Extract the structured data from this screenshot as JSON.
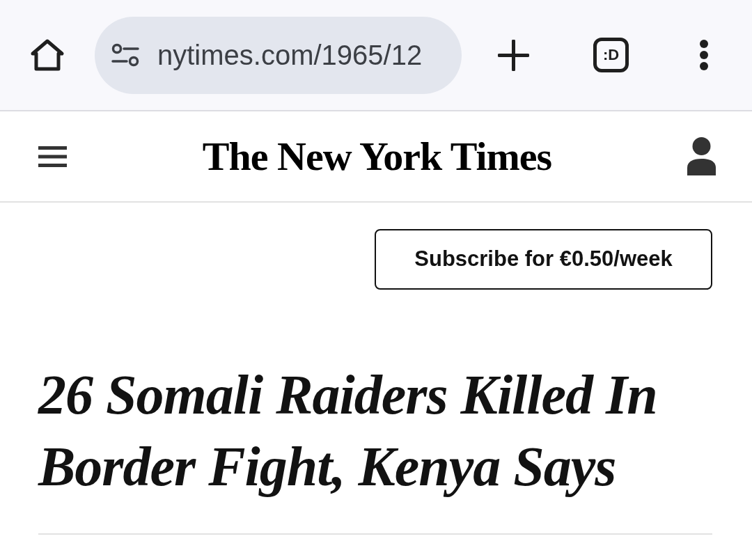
{
  "browser_toolbar": {
    "url": "nytimes.com/1965/12",
    "tab_count": ":D"
  },
  "masthead": {
    "logo": "The New York Times"
  },
  "subscribe_button": {
    "label": "Subscribe for €0.50/week"
  },
  "article": {
    "headline": "26 Somali Raiders Killed In Border Fight, Kenya Says"
  }
}
